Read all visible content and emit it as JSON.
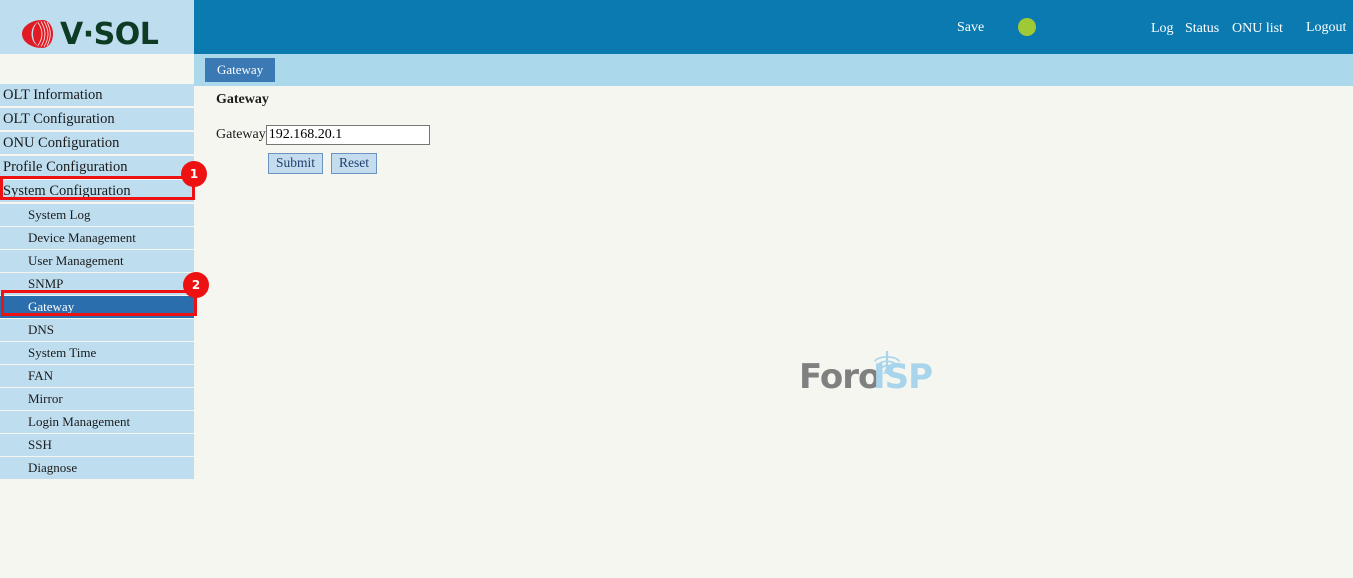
{
  "header": {
    "logo_text": "V·SOL",
    "logo_icon": "vsol-shell-logo",
    "save_label": "Save",
    "status_indicator_color": "#9fca36",
    "links": {
      "log": "Log",
      "status": "Status",
      "onu_list": "ONU list",
      "logout": "Logout"
    }
  },
  "sidebar": {
    "top_items": [
      {
        "label": "OLT Information"
      },
      {
        "label": "OLT Configuration"
      },
      {
        "label": "ONU Configuration"
      },
      {
        "label": "Profile Configuration"
      },
      {
        "label": "System Configuration"
      }
    ],
    "sub_items": [
      {
        "label": "System Log"
      },
      {
        "label": "Device Management"
      },
      {
        "label": "User Management"
      },
      {
        "label": "SNMP"
      },
      {
        "label": "Gateway"
      },
      {
        "label": "DNS"
      },
      {
        "label": "System Time"
      },
      {
        "label": "FAN"
      },
      {
        "label": "Mirror"
      },
      {
        "label": "Login Management"
      },
      {
        "label": "SSH"
      },
      {
        "label": "Diagnose"
      }
    ],
    "active_sub_item": "Gateway"
  },
  "tabs": [
    {
      "label": "Gateway",
      "active": true
    }
  ],
  "main": {
    "title": "Gateway",
    "form": {
      "gateway_label": "Gateway",
      "gateway_value": "192.168.20.1",
      "submit_label": "Submit",
      "reset_label": "Reset"
    }
  },
  "watermark": {
    "text_primary": "Foro",
    "text_secondary": "ISP",
    "color_primary": "#808080",
    "color_secondary": "#a8d4ec"
  },
  "annotations": [
    {
      "number": "1",
      "target": "System Configuration"
    },
    {
      "number": "2",
      "target": "Gateway"
    }
  ],
  "colors": {
    "header_blue": "#0a7ab0",
    "sidebar_blue": "#bedef0",
    "active_blue": "#2a6ead",
    "tabstrip_blue": "#abd8ea",
    "tab_blue": "#3a79b4",
    "annotation_red": "#ee1111",
    "content_bg": "#f4f6ef"
  }
}
